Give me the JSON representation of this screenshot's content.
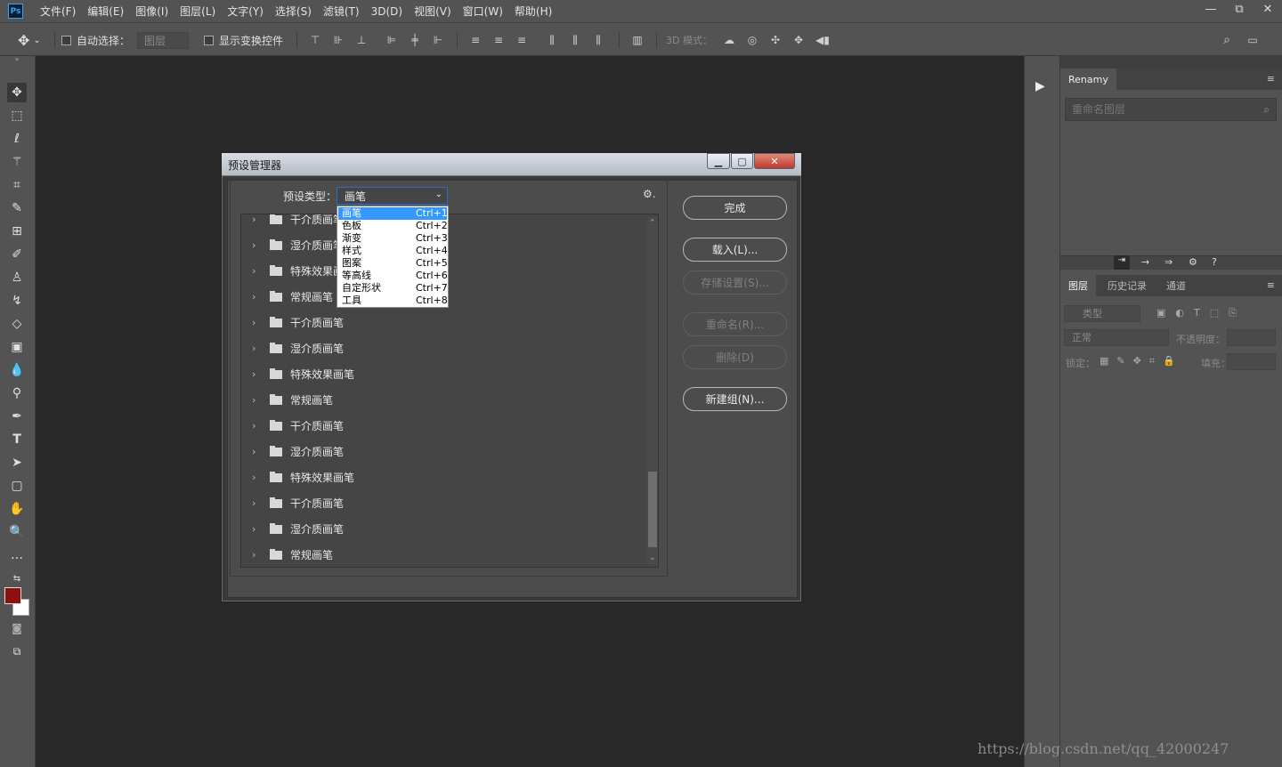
{
  "menubar": {
    "logo": "Ps",
    "items": [
      "文件(F)",
      "编辑(E)",
      "图像(I)",
      "图层(L)",
      "文字(Y)",
      "选择(S)",
      "滤镜(T)",
      "3D(D)",
      "视图(V)",
      "窗口(W)",
      "帮助(H)"
    ]
  },
  "window_controls": {
    "minimize": "—",
    "restore": "⧉",
    "close": "✕"
  },
  "options": {
    "auto_select_label": "自动选择：",
    "auto_select_target": "图层",
    "show_transform_label": "显示变换控件",
    "mode_3d_label": "3D 模式："
  },
  "right_panel": {
    "top_tab": "Renamy",
    "rename_placeholder": "重命名图层",
    "tabs": [
      "图层",
      "历史记录",
      "通道"
    ],
    "filter_label": "类型",
    "blend_mode": "正常",
    "opacity_label": "不透明度：",
    "lock_label": "锁定：",
    "fill_label": "填充："
  },
  "dialog": {
    "title": "预设管理器",
    "preset_type_label": "预设类型：",
    "preset_type_value": "画笔",
    "buttons": {
      "done": "完成",
      "load": "载入(L)...",
      "save": "存储设置(S)...",
      "rename": "重命名(R)...",
      "delete": "删除(D)",
      "new_group": "新建组(N)..."
    },
    "list_rows": [
      "干介质画笔",
      "湿介质画笔",
      "特殊效果画笔",
      "常规画笔",
      "干介质画笔",
      "湿介质画笔",
      "特殊效果画笔",
      "常规画笔",
      "干介质画笔",
      "湿介质画笔",
      "特殊效果画笔",
      "干介质画笔",
      "湿介质画笔",
      "常规画笔"
    ],
    "dropdown_options": [
      {
        "name": "画笔",
        "key": "Ctrl+1"
      },
      {
        "name": "色板",
        "key": "Ctrl+2"
      },
      {
        "name": "渐变",
        "key": "Ctrl+3"
      },
      {
        "name": "样式",
        "key": "Ctrl+4"
      },
      {
        "name": "图案",
        "key": "Ctrl+5"
      },
      {
        "name": "等高线",
        "key": "Ctrl+6"
      },
      {
        "name": "自定形状",
        "key": "Ctrl+7"
      },
      {
        "name": "工具",
        "key": "Ctrl+8"
      }
    ]
  },
  "watermark": "https://blog.csdn.net/qq_42000247",
  "colors": {
    "foreground": "#8b1010",
    "background": "#ffffff",
    "accent": "#3399ff"
  }
}
